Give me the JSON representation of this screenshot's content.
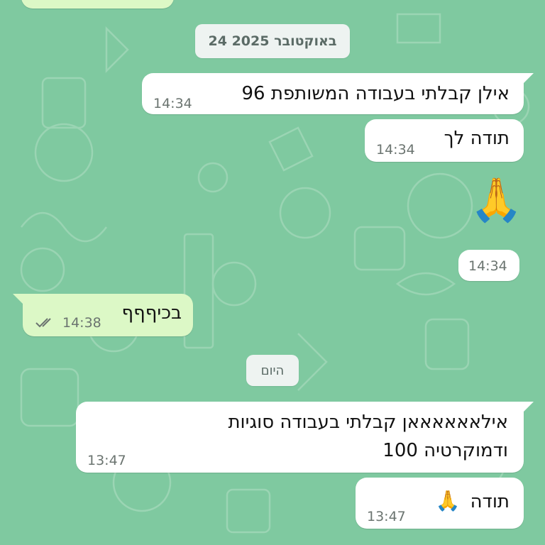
{
  "date_separators": {
    "first": "24 באוקטובר 2025",
    "today": "היום"
  },
  "messages": [
    {
      "direction": "incoming",
      "text": "אילן קבלתי בעבודה המשותפת 96",
      "time": "14:34"
    },
    {
      "direction": "incoming",
      "text": "תודה לך",
      "time": "14:34"
    },
    {
      "direction": "incoming",
      "emoji": "🙏",
      "time": "14:34"
    },
    {
      "direction": "outgoing",
      "text": "בכיףףף",
      "time": "14:38",
      "status": "read"
    },
    {
      "direction": "incoming",
      "text_line1": "אילאאאאאאן קבלתי בעבודה סוגיות",
      "text_line2": "ודמוקרטיה 100",
      "time": "13:47"
    },
    {
      "direction": "incoming",
      "text": "תודה",
      "emoji": "🙏",
      "time": "13:47"
    }
  ],
  "colors": {
    "background": "#7fc9a0",
    "incoming_bubble": "#ffffff",
    "outgoing_bubble": "#dcf8c6",
    "read_ticks": "#6b7470"
  }
}
